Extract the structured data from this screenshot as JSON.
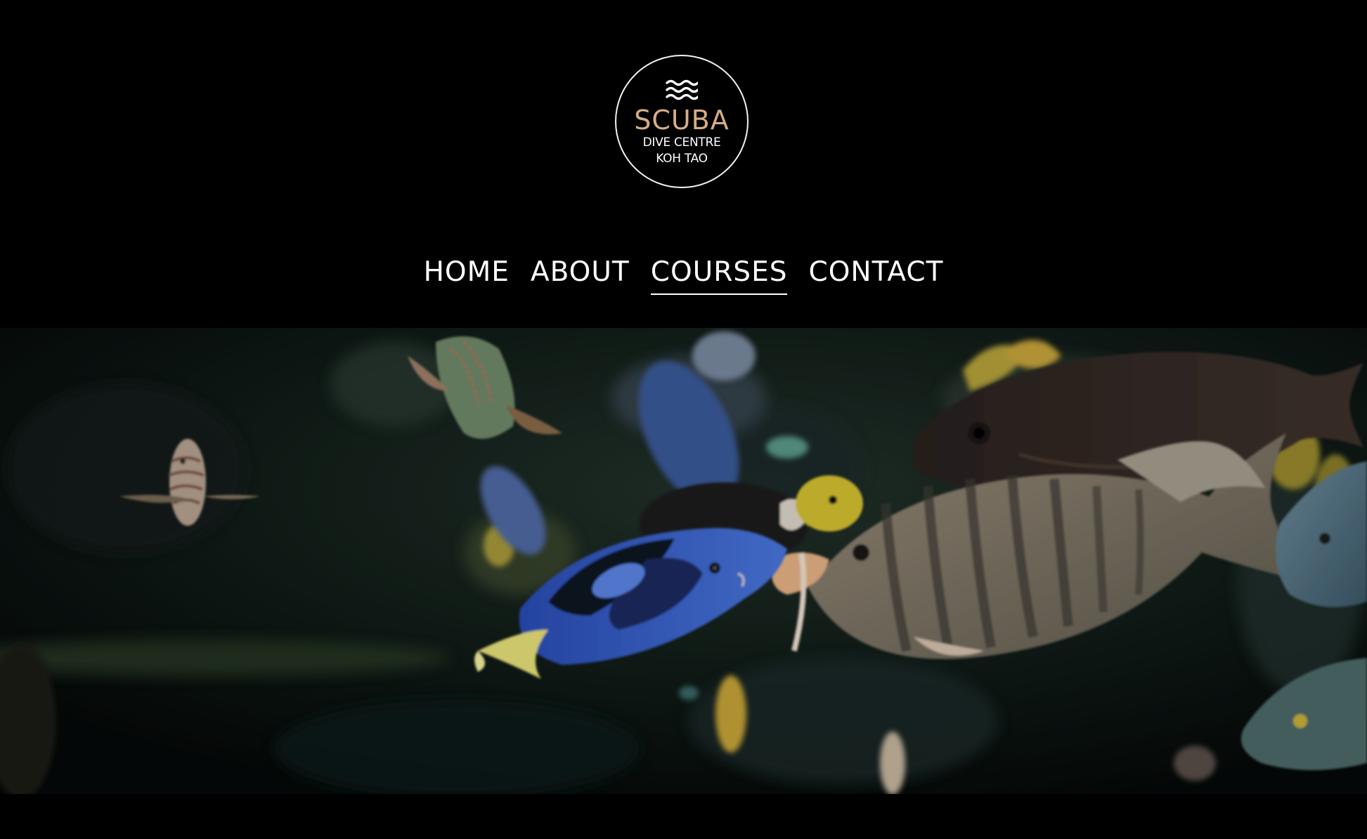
{
  "logo": {
    "icon": "waves-icon",
    "brand": "SCUBA",
    "line1": "DIVE CENTRE",
    "line2": "KOH TAO",
    "brand_color": "#d6ad86"
  },
  "nav": {
    "items": [
      {
        "label": "HOME"
      },
      {
        "label": "ABOUT"
      },
      {
        "label": "COURSES",
        "active": true
      },
      {
        "label": "CONTACT"
      }
    ]
  },
  "hero": {
    "image": "underwater-fish-photo"
  }
}
